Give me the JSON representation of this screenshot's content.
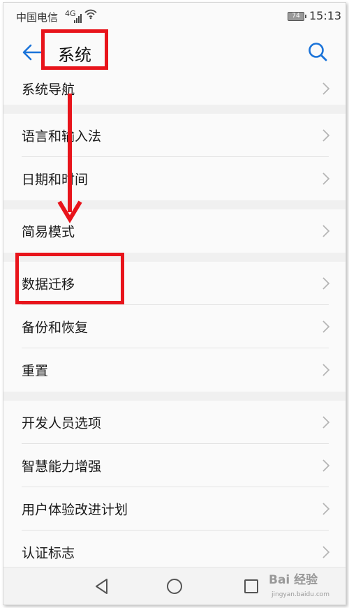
{
  "status_bar": {
    "carrier": "中国电信",
    "network": "4G",
    "battery": "74",
    "time": "15:13"
  },
  "app_bar": {
    "title": "系统",
    "back_icon": "arrow-left-icon",
    "search_icon": "search-icon",
    "accent_color": "#1a73d9"
  },
  "groups": [
    {
      "items": [
        {
          "label": "系统导航"
        }
      ]
    },
    {
      "items": [
        {
          "label": "语言和输入法"
        },
        {
          "label": "日期和时间"
        }
      ]
    },
    {
      "items": [
        {
          "label": "简易模式"
        }
      ]
    },
    {
      "items": [
        {
          "label": "数据迁移"
        },
        {
          "label": "备份和恢复"
        },
        {
          "label": "重置"
        }
      ]
    },
    {
      "items": [
        {
          "label": "开发人员选项"
        },
        {
          "label": "智慧能力增强"
        },
        {
          "label": "用户体验改进计划"
        },
        {
          "label": "认证标志"
        }
      ]
    }
  ],
  "annotation_color": "#e8141b",
  "watermark": {
    "brand": "Bai 经验",
    "url": "jingyan.baidu.com"
  }
}
